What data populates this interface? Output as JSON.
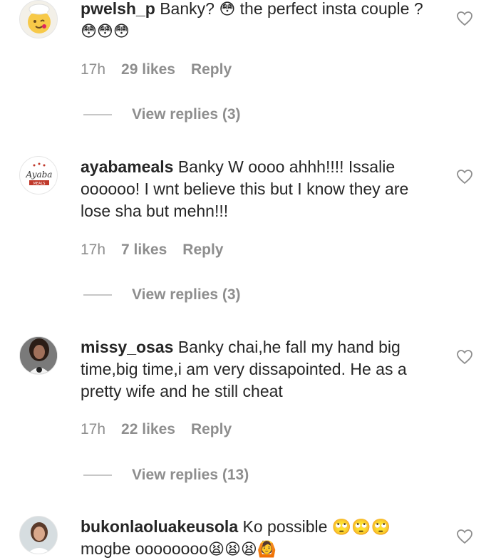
{
  "comments": [
    {
      "username": "pwelsh_p",
      "text_parts": [
        "Banky? ",
        "😳",
        " the perfect insta couple ? ",
        "😳😳😳"
      ],
      "time": "17h",
      "likes": "29 likes",
      "reply": "Reply",
      "view_replies": "View replies (3)",
      "avatar_icon": "chef-emoji-avatar"
    },
    {
      "username": "ayabameals",
      "text": "Banky W oooo ahhh!!!! Issalie oooooo! I wnt believe this but I know they are lose sha but mehn!!!",
      "time": "17h",
      "likes": "7 likes",
      "reply": "Reply",
      "view_replies": "View replies (3)",
      "avatar_logo_text": "Ayaba MEALS",
      "avatar_icon": "ayaba-meals-logo-avatar"
    },
    {
      "username": "missy_osas",
      "text": "Banky chai,he fall my hand big time,big time,i am very dissapointed. He as a pretty wife and he still cheat",
      "time": "17h",
      "likes": "22 likes",
      "reply": "Reply",
      "view_replies": "View replies (13)",
      "avatar_icon": "profile-photo-avatar"
    },
    {
      "username": "bukonlaoluakeusola",
      "text_parts": [
        "Ko possible ",
        "🙄🙄🙄",
        " mogbe oooooooo",
        "😫😫😫🙆"
      ],
      "avatar_icon": "profile-photo-avatar"
    }
  ],
  "colors": {
    "text": "#262626",
    "secondary": "#8e8e8e",
    "divider": "#c7c7c7",
    "heart_stroke": "#8e8e8e"
  }
}
